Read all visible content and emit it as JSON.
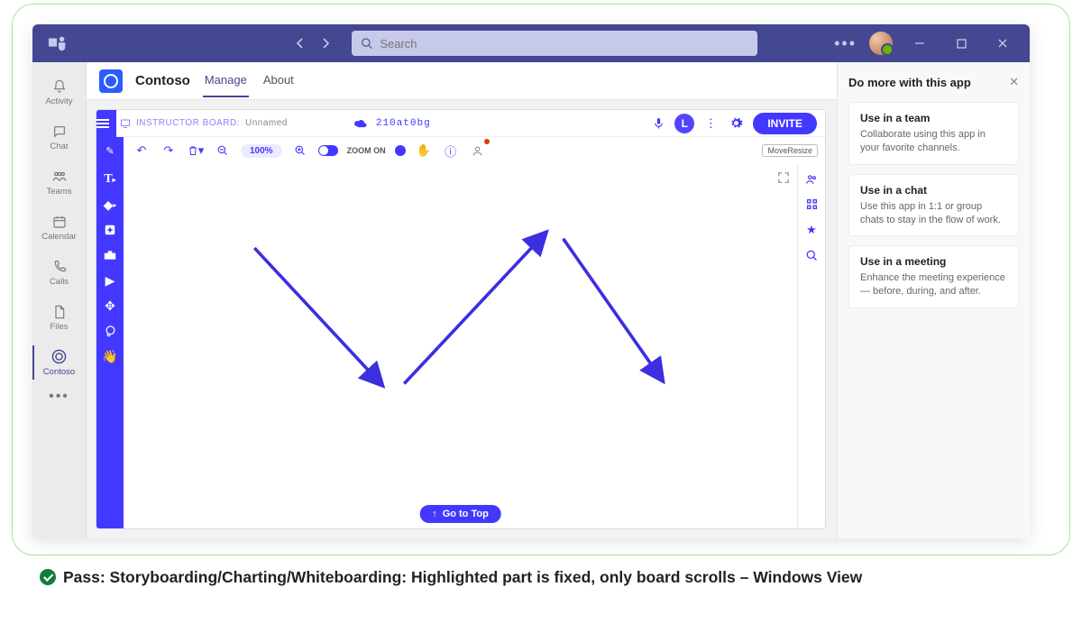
{
  "titlebar": {
    "search_placeholder": "Search"
  },
  "leftnav": {
    "items": [
      {
        "label": "Activity"
      },
      {
        "label": "Chat"
      },
      {
        "label": "Teams"
      },
      {
        "label": "Calendar"
      },
      {
        "label": "Calls"
      },
      {
        "label": "Files"
      },
      {
        "label": "Contoso"
      }
    ]
  },
  "app": {
    "name": "Contoso",
    "tabs": {
      "manage": "Manage",
      "about": "About"
    }
  },
  "board": {
    "instructor_label": "INSTRUCTOR BOARD:",
    "instructor_name": "Unnamed",
    "code": "210at0bg",
    "avatar_initial": "L",
    "invite": "INVITE",
    "zoom_value": "100%",
    "zoom_on": "ZOOM ON",
    "moveresize": "MoveResize",
    "gotop": "Go to Top"
  },
  "sidepanel": {
    "title": "Do more with this app",
    "cards": [
      {
        "title": "Use in a team",
        "body": "Collaborate using this app in your favorite channels."
      },
      {
        "title": "Use in a chat",
        "body": "Use this app in 1:1 or group chats to stay in the flow of work."
      },
      {
        "title": "Use in a meeting",
        "body": "Enhance the meeting experience — before, during, and after."
      }
    ]
  },
  "caption": "Pass: Storyboarding/Charting/Whiteboarding: Highlighted part is fixed, only board scrolls – Windows View"
}
